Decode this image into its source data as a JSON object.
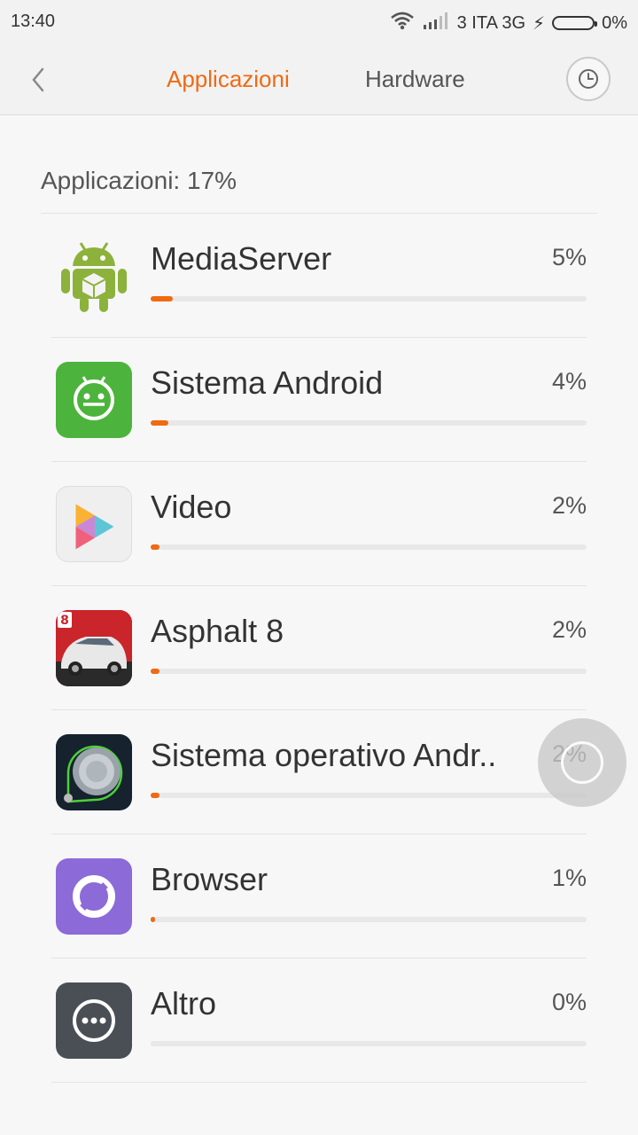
{
  "status_bar": {
    "time": "13:40",
    "carrier": "3 ITA 3G",
    "battery": "0%"
  },
  "header": {
    "tabs": [
      {
        "label": "Applicazioni",
        "active": true
      },
      {
        "label": "Hardware",
        "active": false
      }
    ],
    "accent_color": "#f06a12"
  },
  "section": {
    "title": "Applicazioni: 17%"
  },
  "apps": [
    {
      "name": "MediaServer",
      "percent_label": "5%",
      "usage_fraction": 0.05
    },
    {
      "name": "Sistema Android",
      "percent_label": "4%",
      "usage_fraction": 0.04
    },
    {
      "name": "Video",
      "percent_label": "2%",
      "usage_fraction": 0.02
    },
    {
      "name": "Asphalt 8",
      "percent_label": "2%",
      "usage_fraction": 0.02
    },
    {
      "name": "Sistema operativo Andr..",
      "percent_label": "2%",
      "usage_fraction": 0.02
    },
    {
      "name": "Browser",
      "percent_label": "1%",
      "usage_fraction": 0.01
    },
    {
      "name": "Altro",
      "percent_label": "0%",
      "usage_fraction": 0.0
    }
  ],
  "icons": [
    "android-robot-icon",
    "android-system-icon",
    "video-play-icon",
    "asphalt-8-icon",
    "android-os-icon",
    "browser-icon",
    "more-dots-icon",
    "back-arrow-icon",
    "history-clock-icon",
    "wifi-icon",
    "signal-icon",
    "charging-bolt-icon",
    "battery-icon"
  ]
}
